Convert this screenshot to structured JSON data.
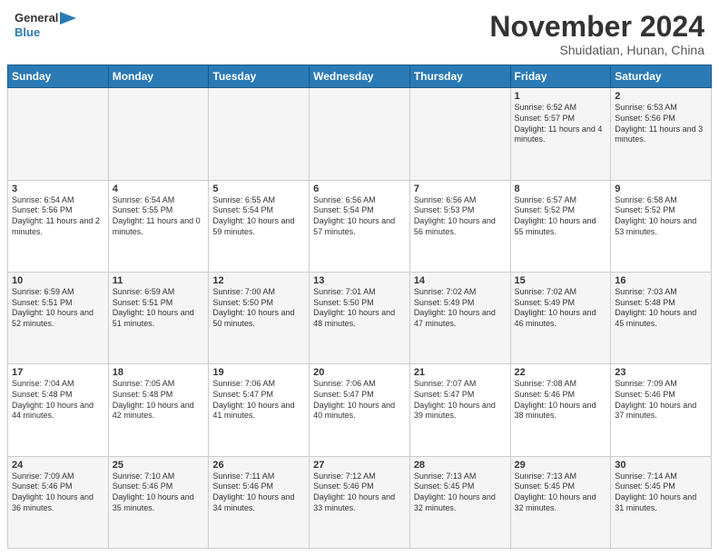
{
  "header": {
    "logo_general": "General",
    "logo_blue": "Blue",
    "month": "November 2024",
    "location": "Shuidatian, Hunan, China"
  },
  "weekdays": [
    "Sunday",
    "Monday",
    "Tuesday",
    "Wednesday",
    "Thursday",
    "Friday",
    "Saturday"
  ],
  "weeks": [
    [
      {
        "day": "",
        "info": ""
      },
      {
        "day": "",
        "info": ""
      },
      {
        "day": "",
        "info": ""
      },
      {
        "day": "",
        "info": ""
      },
      {
        "day": "",
        "info": ""
      },
      {
        "day": "1",
        "info": "Sunrise: 6:52 AM\nSunset: 5:57 PM\nDaylight: 11 hours and 4 minutes."
      },
      {
        "day": "2",
        "info": "Sunrise: 6:53 AM\nSunset: 5:56 PM\nDaylight: 11 hours and 3 minutes."
      }
    ],
    [
      {
        "day": "3",
        "info": "Sunrise: 6:54 AM\nSunset: 5:56 PM\nDaylight: 11 hours and 2 minutes."
      },
      {
        "day": "4",
        "info": "Sunrise: 6:54 AM\nSunset: 5:55 PM\nDaylight: 11 hours and 0 minutes."
      },
      {
        "day": "5",
        "info": "Sunrise: 6:55 AM\nSunset: 5:54 PM\nDaylight: 10 hours and 59 minutes."
      },
      {
        "day": "6",
        "info": "Sunrise: 6:56 AM\nSunset: 5:54 PM\nDaylight: 10 hours and 57 minutes."
      },
      {
        "day": "7",
        "info": "Sunrise: 6:56 AM\nSunset: 5:53 PM\nDaylight: 10 hours and 56 minutes."
      },
      {
        "day": "8",
        "info": "Sunrise: 6:57 AM\nSunset: 5:52 PM\nDaylight: 10 hours and 55 minutes."
      },
      {
        "day": "9",
        "info": "Sunrise: 6:58 AM\nSunset: 5:52 PM\nDaylight: 10 hours and 53 minutes."
      }
    ],
    [
      {
        "day": "10",
        "info": "Sunrise: 6:59 AM\nSunset: 5:51 PM\nDaylight: 10 hours and 52 minutes."
      },
      {
        "day": "11",
        "info": "Sunrise: 6:59 AM\nSunset: 5:51 PM\nDaylight: 10 hours and 51 minutes."
      },
      {
        "day": "12",
        "info": "Sunrise: 7:00 AM\nSunset: 5:50 PM\nDaylight: 10 hours and 50 minutes."
      },
      {
        "day": "13",
        "info": "Sunrise: 7:01 AM\nSunset: 5:50 PM\nDaylight: 10 hours and 48 minutes."
      },
      {
        "day": "14",
        "info": "Sunrise: 7:02 AM\nSunset: 5:49 PM\nDaylight: 10 hours and 47 minutes."
      },
      {
        "day": "15",
        "info": "Sunrise: 7:02 AM\nSunset: 5:49 PM\nDaylight: 10 hours and 46 minutes."
      },
      {
        "day": "16",
        "info": "Sunrise: 7:03 AM\nSunset: 5:48 PM\nDaylight: 10 hours and 45 minutes."
      }
    ],
    [
      {
        "day": "17",
        "info": "Sunrise: 7:04 AM\nSunset: 5:48 PM\nDaylight: 10 hours and 44 minutes."
      },
      {
        "day": "18",
        "info": "Sunrise: 7:05 AM\nSunset: 5:48 PM\nDaylight: 10 hours and 42 minutes."
      },
      {
        "day": "19",
        "info": "Sunrise: 7:06 AM\nSunset: 5:47 PM\nDaylight: 10 hours and 41 minutes."
      },
      {
        "day": "20",
        "info": "Sunrise: 7:06 AM\nSunset: 5:47 PM\nDaylight: 10 hours and 40 minutes."
      },
      {
        "day": "21",
        "info": "Sunrise: 7:07 AM\nSunset: 5:47 PM\nDaylight: 10 hours and 39 minutes."
      },
      {
        "day": "22",
        "info": "Sunrise: 7:08 AM\nSunset: 5:46 PM\nDaylight: 10 hours and 38 minutes."
      },
      {
        "day": "23",
        "info": "Sunrise: 7:09 AM\nSunset: 5:46 PM\nDaylight: 10 hours and 37 minutes."
      }
    ],
    [
      {
        "day": "24",
        "info": "Sunrise: 7:09 AM\nSunset: 5:46 PM\nDaylight: 10 hours and 36 minutes."
      },
      {
        "day": "25",
        "info": "Sunrise: 7:10 AM\nSunset: 5:46 PM\nDaylight: 10 hours and 35 minutes."
      },
      {
        "day": "26",
        "info": "Sunrise: 7:11 AM\nSunset: 5:46 PM\nDaylight: 10 hours and 34 minutes."
      },
      {
        "day": "27",
        "info": "Sunrise: 7:12 AM\nSunset: 5:46 PM\nDaylight: 10 hours and 33 minutes."
      },
      {
        "day": "28",
        "info": "Sunrise: 7:13 AM\nSunset: 5:45 PM\nDaylight: 10 hours and 32 minutes."
      },
      {
        "day": "29",
        "info": "Sunrise: 7:13 AM\nSunset: 5:45 PM\nDaylight: 10 hours and 32 minutes."
      },
      {
        "day": "30",
        "info": "Sunrise: 7:14 AM\nSunset: 5:45 PM\nDaylight: 10 hours and 31 minutes."
      }
    ]
  ]
}
